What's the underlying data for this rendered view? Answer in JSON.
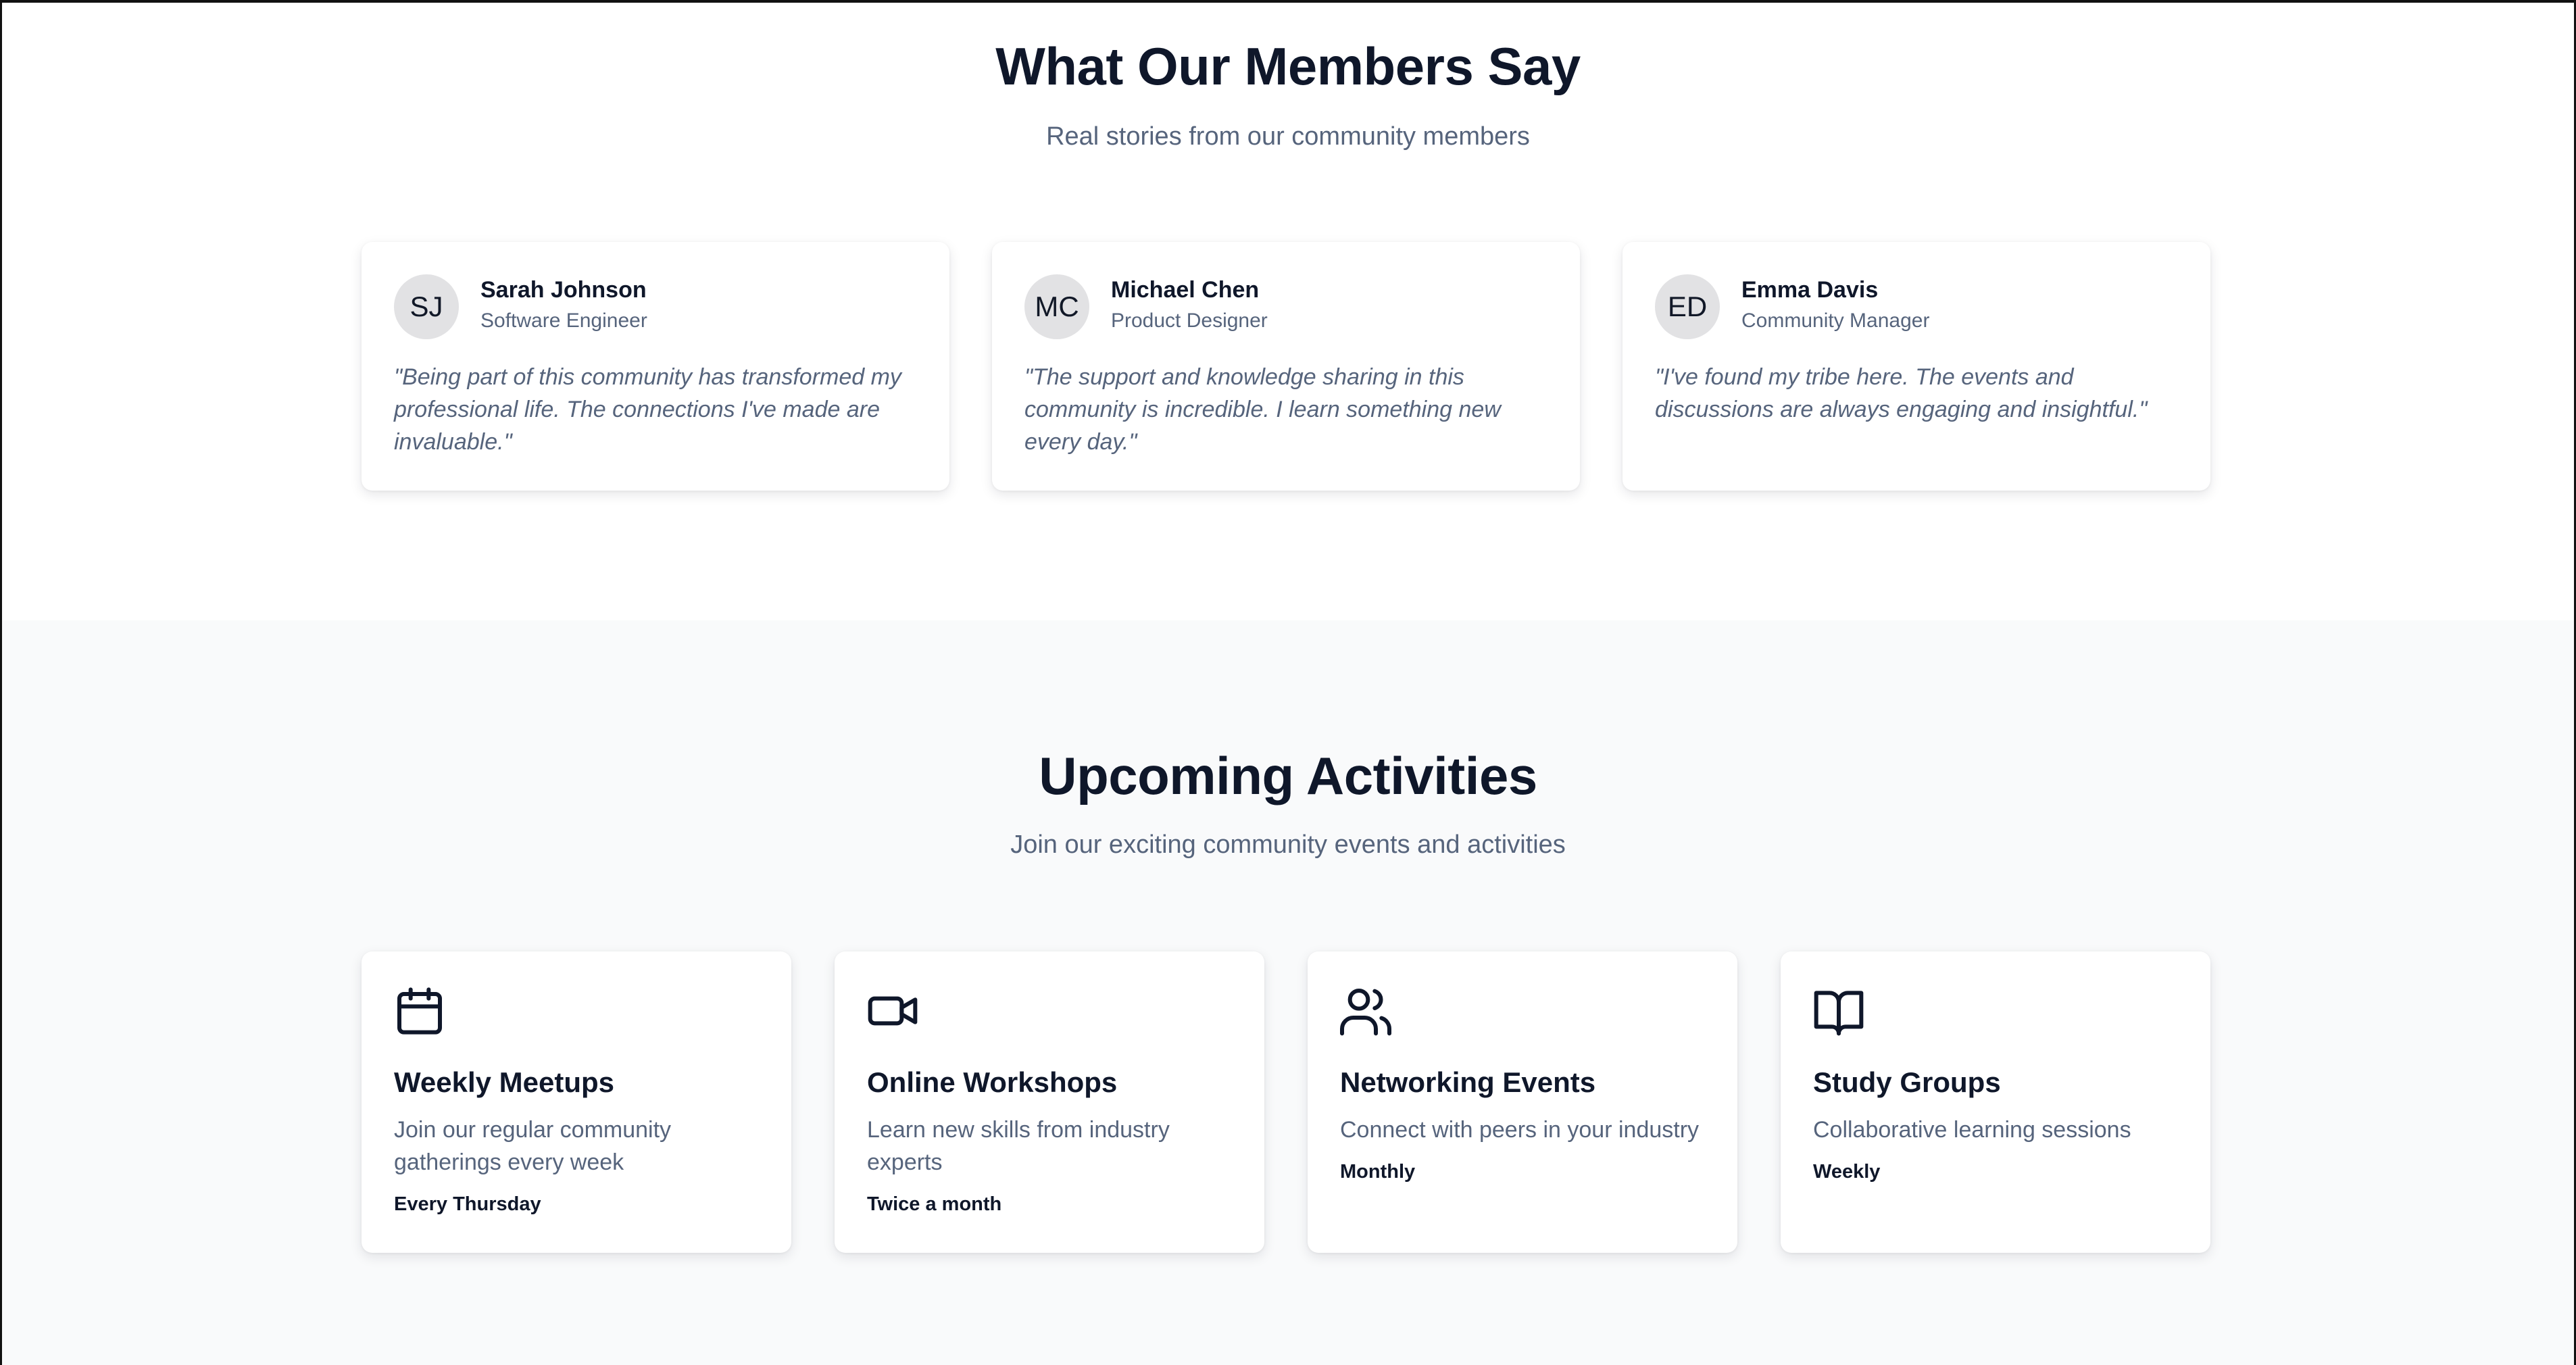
{
  "testimonials": {
    "title": "What Our Members Say",
    "subtitle": "Real stories from our community members",
    "items": [
      {
        "initials": "SJ",
        "name": "Sarah Johnson",
        "role": "Software Engineer",
        "quote": "\"Being part of this community has transformed my professional life. The connections I've made are invaluable.\""
      },
      {
        "initials": "MC",
        "name": "Michael Chen",
        "role": "Product Designer",
        "quote": "\"The support and knowledge sharing in this community is incredible. I learn something new every day.\""
      },
      {
        "initials": "ED",
        "name": "Emma Davis",
        "role": "Community Manager",
        "quote": "\"I've found my tribe here. The events and discussions are always engaging and insightful.\""
      }
    ]
  },
  "activities": {
    "title": "Upcoming Activities",
    "subtitle": "Join our exciting community events and activities",
    "items": [
      {
        "icon": "calendar-icon",
        "name": "Weekly Meetups",
        "description": "Join our regular community gatherings every week",
        "frequency": "Every Thursday"
      },
      {
        "icon": "video-camera-icon",
        "name": "Online Workshops",
        "description": "Learn new skills from industry experts",
        "frequency": "Twice a month"
      },
      {
        "icon": "users-icon",
        "name": "Networking Events",
        "description": "Connect with peers in your industry",
        "frequency": "Monthly"
      },
      {
        "icon": "open-book-icon",
        "name": "Study Groups",
        "description": "Collaborative learning sessions",
        "frequency": "Weekly"
      }
    ]
  },
  "colors": {
    "heading": "#0f172a",
    "muted_text": "#56647c",
    "section_alt_background": "#f9fafb",
    "avatar_background": "#e2e2e4"
  }
}
